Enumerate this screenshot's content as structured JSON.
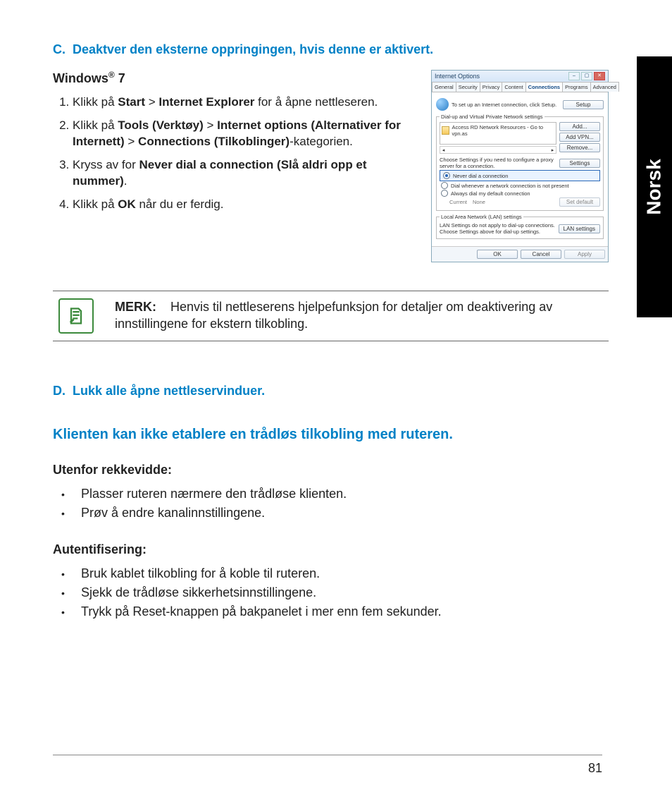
{
  "language_tab": "Norsk",
  "page_number": "81",
  "section_c": {
    "letter": "C.",
    "title": "Deaktver den eksterne oppringingen, hvis denne er aktivert.",
    "os_heading_prefix": "Windows",
    "os_heading_suffix": " 7",
    "steps": {
      "s1_a": "Klikk på ",
      "s1_b1": "Start",
      "s1_gt1": " > ",
      "s1_b2": "Internet Explorer",
      "s1_c": " for å åpne nettleseren.",
      "s2_a": "Klikk på ",
      "s2_b1": "Tools (Verktøy)",
      "s2_gt1": " > ",
      "s2_b2": "Internet options (Alternativer for Internett)",
      "s2_gt2": " > ",
      "s2_b3": "Connections (Tilkoblinger)",
      "s2_c": "-kategorien.",
      "s3_a": "Kryss av for ",
      "s3_b": "Never dial a connection (Slå aldri opp et nummer)",
      "s3_c": ".",
      "s4_a": "Klikk på ",
      "s4_b": "OK",
      "s4_c": " når du er ferdig."
    }
  },
  "dialog": {
    "title": "Internet Options",
    "tabs": [
      "General",
      "Security",
      "Privacy",
      "Content",
      "Connections",
      "Programs",
      "Advanced"
    ],
    "active_tab": "Connections",
    "setup_line": "To set up an Internet connection, click Setup.",
    "btn_setup": "Setup",
    "fs1_legend": "Dial-up and Virtual Private Network settings",
    "list_item": "Access RD Network Resources - Go to vpn.as",
    "btn_add": "Add...",
    "btn_add_vpn": "Add VPN...",
    "btn_remove": "Remove...",
    "proxy_text": "Choose Settings if you need to configure a proxy server for a connection.",
    "btn_settings": "Settings",
    "radio_never": "Never dial a connection",
    "radio_whenever": "Dial whenever a network connection is not present",
    "radio_always": "Always dial my default connection",
    "current_label": "Current",
    "current_value": "None",
    "btn_set_default": "Set default",
    "fs2_legend": "Local Area Network (LAN) settings",
    "lan_text": "LAN Settings do not apply to dial-up connections. Choose Settings above for dial-up settings.",
    "btn_lan": "LAN settings",
    "btn_ok": "OK",
    "btn_cancel": "Cancel",
    "btn_apply": "Apply"
  },
  "note": {
    "label": "MERK:",
    "text": "Henvis til nettleserens hjelpefunksjon for detaljer om deaktivering av innstillingene for ekstern tilkobling."
  },
  "section_d": {
    "letter": "D.",
    "title": "Lukk alle åpne nettleservinduer."
  },
  "klient": {
    "title": "Klienten kan ikke etablere en trådløs tilkobling med ruteren.",
    "range_heading": "Utenfor rekkevidde:",
    "range_items": [
      "Plasser ruteren nærmere den trådløse klienten.",
      "Prøv å endre kanalinnstillingene."
    ],
    "auth_heading": "Autentifisering:",
    "auth_items": [
      "Bruk kablet tilkobling for å koble til ruteren.",
      "Sjekk de trådløse sikkerhetsinnstillingene.",
      "Trykk på Reset-knappen på bakpanelet i mer enn fem sekunder."
    ]
  }
}
